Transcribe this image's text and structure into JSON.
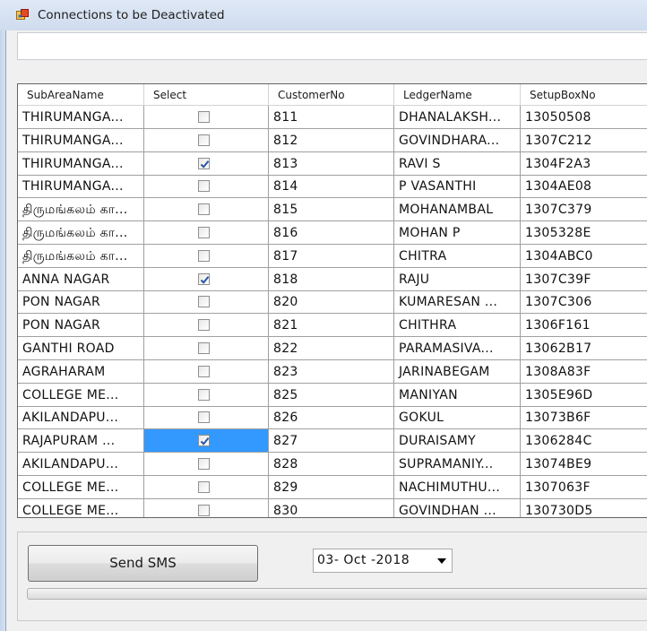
{
  "window": {
    "title": "Connections to be Deactivated",
    "icon": "app-form-icon"
  },
  "top_field": {
    "value": ""
  },
  "grid": {
    "columns": [
      "SubAreaName",
      "Select",
      "CustomerNo",
      "LedgerName",
      "SetupBoxNo"
    ],
    "rows": [
      {
        "subarea": "THIRUMANGA...",
        "checked": false,
        "customer": "811",
        "ledger": "DHANALAKSH...",
        "setupbox": "13050508"
      },
      {
        "subarea": "THIRUMANGA...",
        "checked": false,
        "customer": "812",
        "ledger": "GOVINDHARA...",
        "setupbox": "1307C212"
      },
      {
        "subarea": "THIRUMANGA...",
        "checked": true,
        "customer": "813",
        "ledger": "RAVI S",
        "setupbox": "1304F2A3"
      },
      {
        "subarea": "THIRUMANGA...",
        "checked": false,
        "customer": "814",
        "ledger": "P VASANTHI",
        "setupbox": "1304AE08"
      },
      {
        "subarea": "திருமங்கலம் கா...",
        "checked": false,
        "customer": "815",
        "ledger": "MOHANAMBAL",
        "setupbox": "1307C379"
      },
      {
        "subarea": "திருமங்கலம் கா...",
        "checked": false,
        "customer": "816",
        "ledger": "MOHAN P",
        "setupbox": "1305328E"
      },
      {
        "subarea": "திருமங்கலம் கா...",
        "checked": false,
        "customer": "817",
        "ledger": "CHITRA",
        "setupbox": "1304ABC0"
      },
      {
        "subarea": "ANNA NAGAR",
        "checked": true,
        "customer": "818",
        "ledger": "RAJU",
        "setupbox": "1307C39F"
      },
      {
        "subarea": "PON NAGAR",
        "checked": false,
        "customer": "820",
        "ledger": "KUMARESAN ...",
        "setupbox": "1307C306"
      },
      {
        "subarea": "PON NAGAR",
        "checked": false,
        "customer": "821",
        "ledger": "CHITHRA",
        "setupbox": "1306F161"
      },
      {
        "subarea": "GANTHI ROAD",
        "checked": false,
        "customer": "822",
        "ledger": "PARAMASIVA...",
        "setupbox": "13062B17"
      },
      {
        "subarea": "AGRAHARAM",
        "checked": false,
        "customer": "823",
        "ledger": "JARINABEGAM",
        "setupbox": "1308A83F"
      },
      {
        "subarea": "COLLEGE ME...",
        "checked": false,
        "customer": "825",
        "ledger": "MANIYAN",
        "setupbox": "1305E96D"
      },
      {
        "subarea": "AKILANDAPU...",
        "checked": false,
        "customer": "826",
        "ledger": "GOKUL",
        "setupbox": "13073B6F"
      },
      {
        "subarea": "RAJAPURAM ...",
        "checked": true,
        "customer": "827",
        "ledger": "DURAISAMY",
        "setupbox": "1306284C",
        "selected_cell": true
      },
      {
        "subarea": "AKILANDAPU...",
        "checked": false,
        "customer": "828",
        "ledger": "SUPRAMANIY...",
        "setupbox": "13074BE9"
      },
      {
        "subarea": "COLLEGE ME...",
        "checked": false,
        "customer": "829",
        "ledger": "NACHIMUTHU...",
        "setupbox": "1307063F"
      },
      {
        "subarea": "COLLEGE ME...",
        "checked": false,
        "customer": "830",
        "ledger": "GOVINDHAN ...",
        "setupbox": "130730D5"
      }
    ]
  },
  "actions": {
    "send_sms_label": "Send SMS"
  },
  "date_picker": {
    "value": "03- Oct -2018"
  },
  "progress": {
    "value": 0
  },
  "colors": {
    "selection": "#3399ff",
    "check_mark": "#2a55a8"
  }
}
